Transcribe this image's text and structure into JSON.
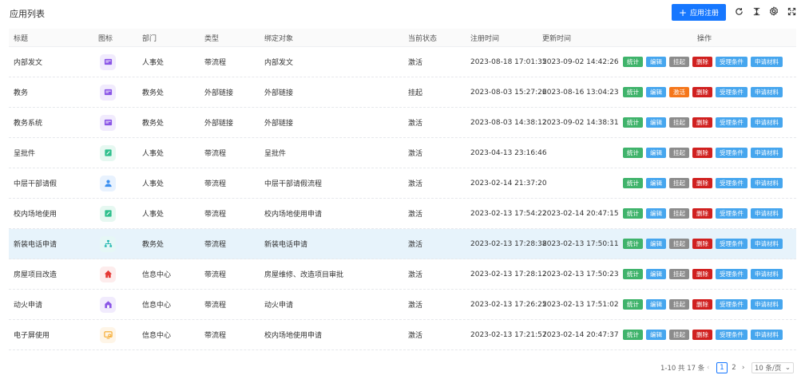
{
  "page": {
    "title": "应用列表"
  },
  "toolbar": {
    "register_label": "应用注册",
    "icons": [
      "refresh-icon",
      "density-icon",
      "settings-icon",
      "fullscreen-icon"
    ]
  },
  "columns": {
    "title": "标题",
    "icon": "图标",
    "dept": "部门",
    "type": "类型",
    "target": "绑定对象",
    "status": "当前状态",
    "registered": "注册时间",
    "updated": "更新时间",
    "ops": "操作"
  },
  "ops_labels": {
    "stat": "统计",
    "edit": "编辑",
    "hang": "挂起",
    "act": "激活",
    "del": "删除",
    "cond": "受理条件",
    "mat": "申请材料"
  },
  "rows": [
    {
      "title": "内部发文",
      "icon": "document-icon",
      "icon_color": "#8a55e6",
      "icon_bg": "#f1ebfd",
      "dept": "人事处",
      "type": "带流程",
      "target": "内部发文",
      "status": "激活",
      "registered": "2023-08-18 17:01:35",
      "updated": "2023-09-02 14:42:26",
      "state_op": "hang"
    },
    {
      "title": "教务",
      "icon": "document-icon",
      "icon_color": "#8a55e6",
      "icon_bg": "#f1ebfd",
      "dept": "教务处",
      "type": "外部链接",
      "target": "外部链接",
      "status": "挂起",
      "registered": "2023-08-03 15:27:26",
      "updated": "2023-08-16 13:04:23",
      "state_op": "act"
    },
    {
      "title": "教务系统",
      "icon": "document-icon",
      "icon_color": "#8a55e6",
      "icon_bg": "#f1ebfd",
      "dept": "教务处",
      "type": "外部链接",
      "target": "外部链接",
      "status": "激活",
      "registered": "2023-08-03 14:38:12",
      "updated": "2023-09-02 14:38:31",
      "state_op": "hang"
    },
    {
      "title": "呈批件",
      "icon": "edit-icon",
      "icon_color": "#2ebf8c",
      "icon_bg": "#e6f8f1",
      "dept": "人事处",
      "type": "带流程",
      "target": "呈批件",
      "status": "激活",
      "registered": "2023-04-13 23:16:46",
      "updated": "",
      "state_op": "hang"
    },
    {
      "title": "中层干部请假",
      "icon": "user-icon",
      "icon_color": "#3b8ff0",
      "icon_bg": "#e8f2fe",
      "dept": "人事处",
      "type": "带流程",
      "target": "中层干部请假流程",
      "status": "激活",
      "registered": "2023-02-14 21:37:20",
      "updated": "",
      "state_op": "hang"
    },
    {
      "title": "校内场地使用",
      "icon": "edit-icon",
      "icon_color": "#2ebf8c",
      "icon_bg": "#e6f8f1",
      "dept": "人事处",
      "type": "带流程",
      "target": "校内场地使用申请",
      "status": "激活",
      "registered": "2023-02-13 17:54:22",
      "updated": "2023-02-14 20:47:15",
      "state_op": "hang"
    },
    {
      "title": "新装电话申请",
      "icon": "org-chart-icon",
      "icon_color": "#22b8b0",
      "icon_bg": "#e6f7f6",
      "dept": "教务处",
      "type": "带流程",
      "target": "新装电话申请",
      "status": "激活",
      "registered": "2023-02-13 17:28:38",
      "updated": "2023-02-13 17:50:11",
      "state_op": "hang",
      "highlight": true
    },
    {
      "title": "房屋项目改造",
      "icon": "home-icon",
      "icon_color": "#e53935",
      "icon_bg": "#fdecec",
      "dept": "信息中心",
      "type": "带流程",
      "target": "房屋维修、改造项目审批",
      "status": "激活",
      "registered": "2023-02-13 17:28:12",
      "updated": "2023-02-13 17:50:23",
      "state_op": "hang"
    },
    {
      "title": "动火申请",
      "icon": "house-icon",
      "icon_color": "#8a55e6",
      "icon_bg": "#f1ebfd",
      "dept": "信息中心",
      "type": "带流程",
      "target": "动火申请",
      "status": "激活",
      "registered": "2023-02-13 17:26:25",
      "updated": "2023-02-13 17:51:02",
      "state_op": "hang"
    },
    {
      "title": "电子屏使用",
      "icon": "screen-icon",
      "icon_color": "#f5a623",
      "icon_bg": "#fef5e7",
      "dept": "信息中心",
      "type": "带流程",
      "target": "校内场地使用申请",
      "status": "激活",
      "registered": "2023-02-13 17:21:57",
      "updated": "2023-02-14 20:47:37",
      "state_op": "hang"
    }
  ],
  "pagination": {
    "total_text": "1-10 共 17 条",
    "prev": "‹",
    "pages": [
      "1",
      "2"
    ],
    "current": "1",
    "next": "›",
    "page_size": "10 条/页"
  }
}
